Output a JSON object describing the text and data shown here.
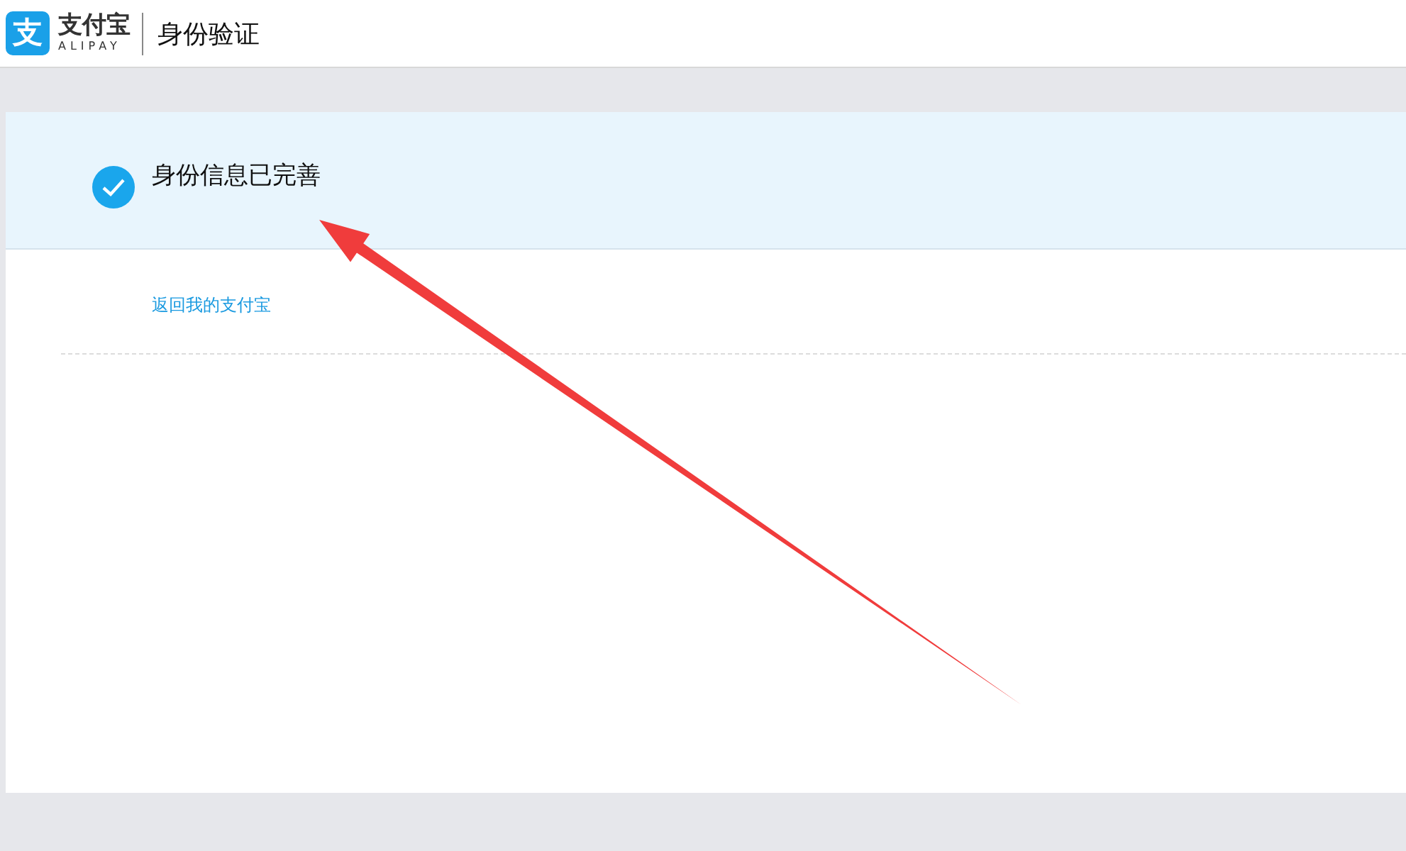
{
  "header": {
    "logo": {
      "glyph": "支",
      "name": "支付宝",
      "latin": "ALIPAY"
    },
    "title": "身份验证"
  },
  "status": {
    "message": "身份信息已完善",
    "checked": true
  },
  "link": "返回我的支付宝",
  "annotation": {
    "kind": "arrow"
  }
}
